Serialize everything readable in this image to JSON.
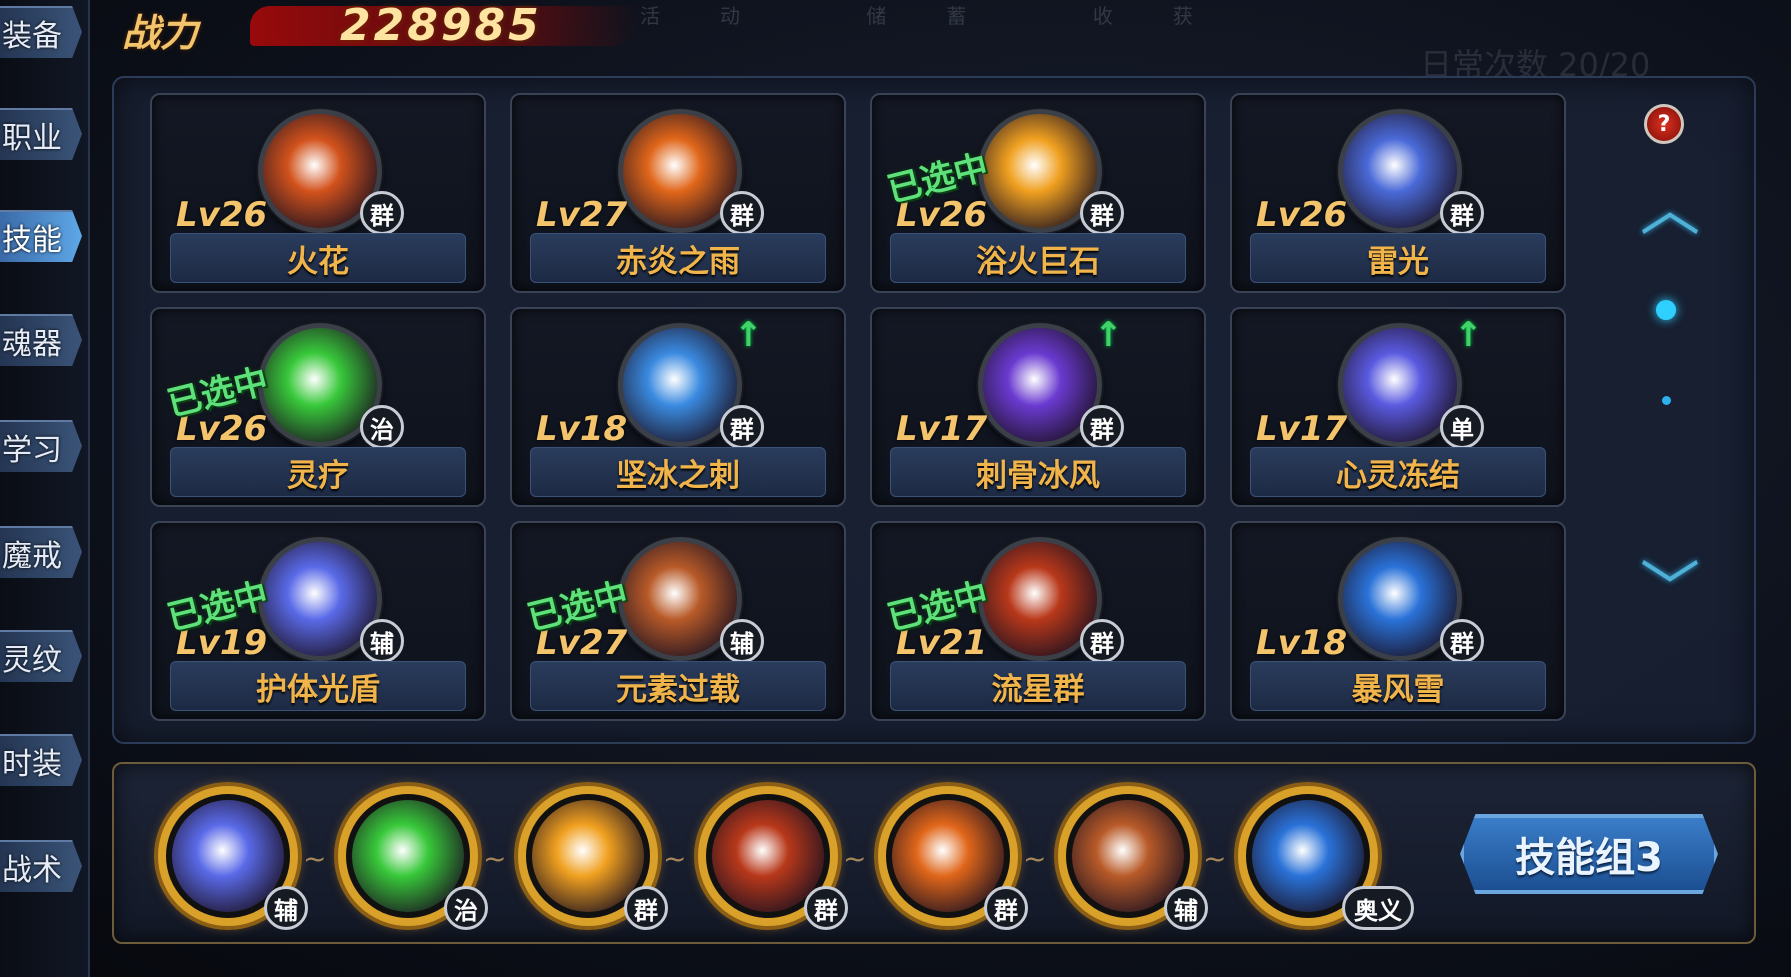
{
  "header": {
    "power_label": "战力",
    "power_value": "228985",
    "faded_tabs": "活动 储蓄 收获",
    "faded_daily": "日常次数 20/20"
  },
  "sidebar": {
    "items": [
      {
        "label": "装备",
        "active": false
      },
      {
        "label": "职业",
        "active": false
      },
      {
        "label": "技能",
        "active": true
      },
      {
        "label": "魂器",
        "active": false
      },
      {
        "label": "学习",
        "active": false
      },
      {
        "label": "魔戒",
        "active": false
      },
      {
        "label": "灵纹",
        "active": false
      },
      {
        "label": "时装",
        "active": false
      },
      {
        "label": "战术",
        "active": false
      }
    ]
  },
  "skills": [
    {
      "level": "Lv26",
      "name": "火花",
      "type": "群",
      "selected": false,
      "upgrade": false,
      "color": "#d2521c"
    },
    {
      "level": "Lv27",
      "name": "赤炎之雨",
      "type": "群",
      "selected": false,
      "upgrade": false,
      "color": "#e0661a"
    },
    {
      "level": "Lv26",
      "name": "浴火巨石",
      "type": "群",
      "selected": true,
      "upgrade": false,
      "color": "#f0a020"
    },
    {
      "level": "Lv26",
      "name": "雷光",
      "type": "群",
      "selected": false,
      "upgrade": false,
      "color": "#4a6ad8"
    },
    {
      "level": "Lv26",
      "name": "灵疗",
      "type": "治",
      "selected": true,
      "upgrade": false,
      "color": "#38c83a"
    },
    {
      "level": "Lv18",
      "name": "坚冰之刺",
      "type": "群",
      "selected": false,
      "upgrade": true,
      "color": "#3a8ae0"
    },
    {
      "level": "Lv17",
      "name": "刺骨冰风",
      "type": "群",
      "selected": false,
      "upgrade": true,
      "color": "#6a3ad0"
    },
    {
      "level": "Lv17",
      "name": "心灵冻结",
      "type": "单",
      "selected": false,
      "upgrade": true,
      "color": "#5a5ae0"
    },
    {
      "level": "Lv19",
      "name": "护体光盾",
      "type": "辅",
      "selected": true,
      "upgrade": false,
      "color": "#5a6ae8"
    },
    {
      "level": "Lv27",
      "name": "元素过载",
      "type": "辅",
      "selected": true,
      "upgrade": false,
      "color": "#b85a28"
    },
    {
      "level": "Lv21",
      "name": "流星群",
      "type": "群",
      "selected": true,
      "upgrade": false,
      "color": "#b8381a"
    },
    {
      "level": "Lv18",
      "name": "暴风雪",
      "type": "群",
      "selected": false,
      "upgrade": false,
      "color": "#2a72d8"
    }
  ],
  "selected_label": "已选中",
  "upgrade_icon": "↑",
  "help_label": "?",
  "scroll": {
    "up": "︿",
    "down": "﹀"
  },
  "equipped_slots": [
    {
      "type": "辅",
      "color": "#5a6ae8"
    },
    {
      "type": "治",
      "color": "#38c83a"
    },
    {
      "type": "群",
      "color": "#f0a020"
    },
    {
      "type": "群",
      "color": "#b8381a"
    },
    {
      "type": "群",
      "color": "#e0661a"
    },
    {
      "type": "辅",
      "color": "#b85a28"
    },
    {
      "type": "奥义",
      "color": "#2a72d8"
    }
  ],
  "slot_separator": "~",
  "group_button": "技能组3"
}
